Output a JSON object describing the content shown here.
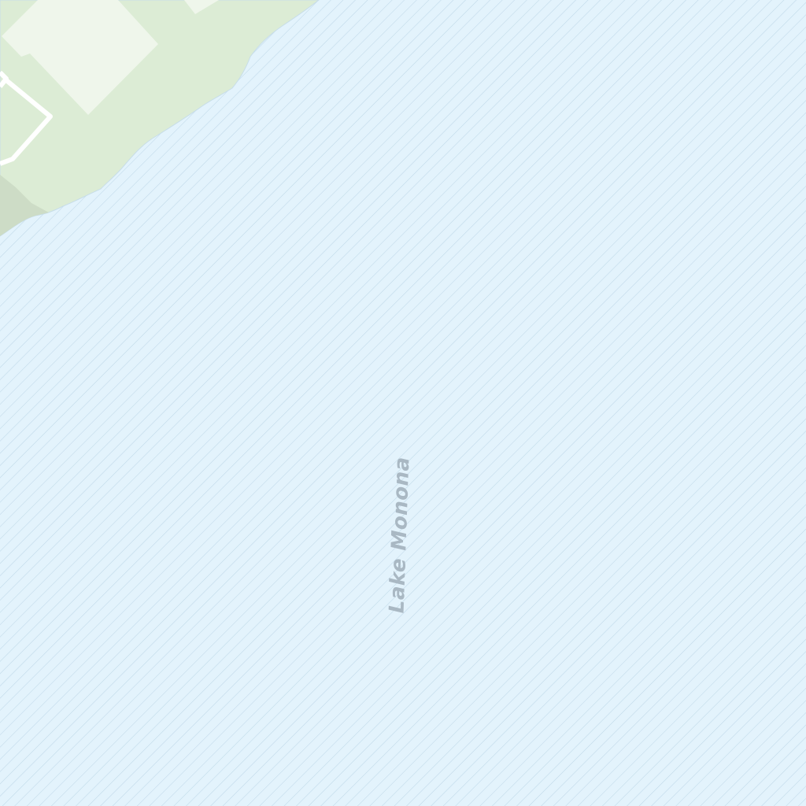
{
  "map": {
    "water_body": {
      "name": "Lake Monona",
      "fill_color": "#e3f3fc",
      "hatch_color": "#b9d3e3",
      "label_color": "#a9b8c3"
    },
    "land": {
      "park_color": "#dcecd5",
      "park_dark_color": "#cddcc6",
      "building_color": "#eff6eb",
      "path_color": "#ffffff",
      "shoreline_color": "#c7dde9"
    }
  }
}
